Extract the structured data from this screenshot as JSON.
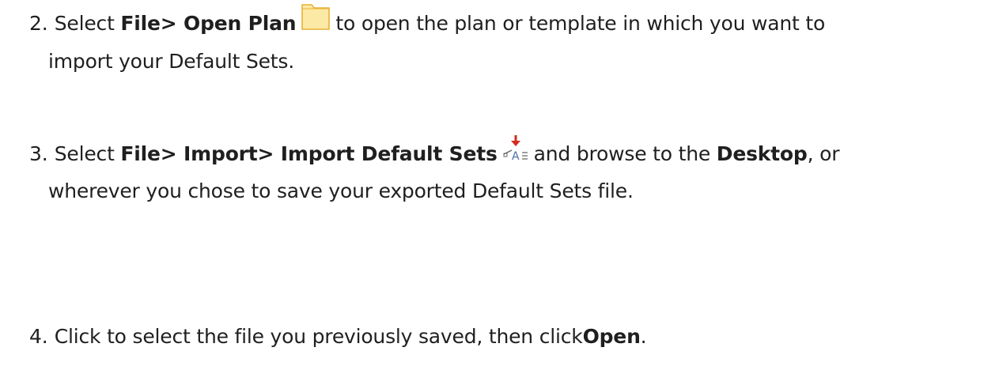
{
  "steps": [
    {
      "number": "2.",
      "prefix": "Select ",
      "menu_path": "File> Open Plan",
      "icon": "open-plan-folder-icon",
      "line1_suffix": "to open the plan or template in which you want to",
      "line2": "import your Default Sets."
    },
    {
      "number": "3.",
      "prefix": "Select ",
      "menu_path": "File> Import> Import Default Sets",
      "icon": "import-default-sets-icon",
      "line1_mid": "and browse to the ",
      "bold_location": "Desktop",
      "line1_end": ", or",
      "line2": "wherever you chose to save your exported Default Sets file."
    },
    {
      "number": "4.",
      "text": "Click to select the file you previously saved, then click",
      "bold_action": "Open",
      "end": "."
    }
  ],
  "colors": {
    "text": "#1f1f1f",
    "folder_fill": "#fde9a6",
    "folder_stroke": "#e7b233",
    "import_arrow": "#d42b1e",
    "import_letter": "#4a6fa5"
  }
}
